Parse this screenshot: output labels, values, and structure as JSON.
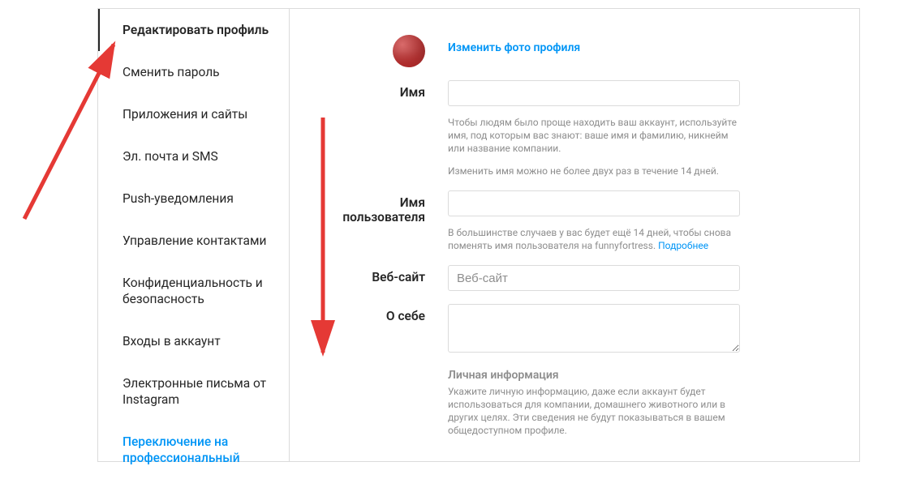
{
  "sidebar": {
    "items": [
      {
        "label": "Редактировать профиль",
        "active": true
      },
      {
        "label": "Сменить пароль"
      },
      {
        "label": "Приложения и сайты"
      },
      {
        "label": "Эл. почта и SMS"
      },
      {
        "label": "Push-уведомления"
      },
      {
        "label": "Управление контактами"
      },
      {
        "label": "Конфиденциальность и безопасность"
      },
      {
        "label": "Входы в аккаунт"
      },
      {
        "label": "Электронные письма от Instagram"
      },
      {
        "label": "Переключение на профессиональный",
        "link": true
      }
    ]
  },
  "profile": {
    "change_photo": "Изменить фото профиля",
    "name_label": "Имя",
    "name_value": "",
    "name_help1": "Чтобы людям было проще находить ваш аккаунт, используйте имя, под которым вас знают: ваше имя и фамилию, никнейм или название компании.",
    "name_help2": "Изменить имя можно не более двух раз в течение 14 дней.",
    "username_label": "Имя пользователя",
    "username_value": "",
    "username_help_prefix": "В большинстве случаев у вас будет ещё 14 дней, чтобы снова поменять имя пользователя на funnyfortress. ",
    "username_help_link": "Подробнее",
    "website_label": "Веб-сайт",
    "website_placeholder": "Веб-сайт",
    "website_value": "",
    "bio_label": "О себе",
    "bio_value": "",
    "personal_title": "Личная информация",
    "personal_help": "Укажите личную информацию, даже если аккаунт будет использоваться для компании, домашнего животного или в других целях. Эти сведения не будут показываться в вашем общедоступном профиле."
  }
}
